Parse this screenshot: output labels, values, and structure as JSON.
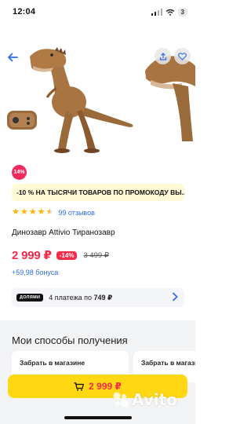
{
  "status_bar": {
    "time": "12:04",
    "battery": "3"
  },
  "product": {
    "discount_badge": "14%",
    "promo_text": "-10 % НА ТЫСЯЧИ ТОВАРОВ ПО ПРОМОКОДУ ВЫ...",
    "rating_stars": 4.5,
    "reviews_text": "99 отзывов",
    "title": "Динозавр Attivio Тиранозавр",
    "price": "2 999 ₽",
    "price_discount": "-14%",
    "old_price": "3 499 ₽",
    "bonus": "+59,98 бонуса"
  },
  "installments": {
    "logo": "ДОЛЯМИ",
    "text_prefix": "4 платежа по ",
    "amount": "749 ₽"
  },
  "delivery": {
    "section_title": "Мои способы получения",
    "cards": [
      "Забрать в магазине",
      "Забрать в магазине"
    ]
  },
  "cart_button": {
    "price": "2 999 ₽"
  },
  "watermark": {
    "text": "Avito"
  },
  "colors": {
    "accent_red": "#f22b4b",
    "link_blue": "#2d6de8",
    "cart_yellow": "#ffd712",
    "promo_bg": "#fff9d5"
  },
  "icons": [
    "wifi-icon",
    "signal-icon",
    "back-arrow-icon",
    "share-icon",
    "favorite-heart-icon",
    "cart-icon",
    "chevron-right-icon"
  ]
}
